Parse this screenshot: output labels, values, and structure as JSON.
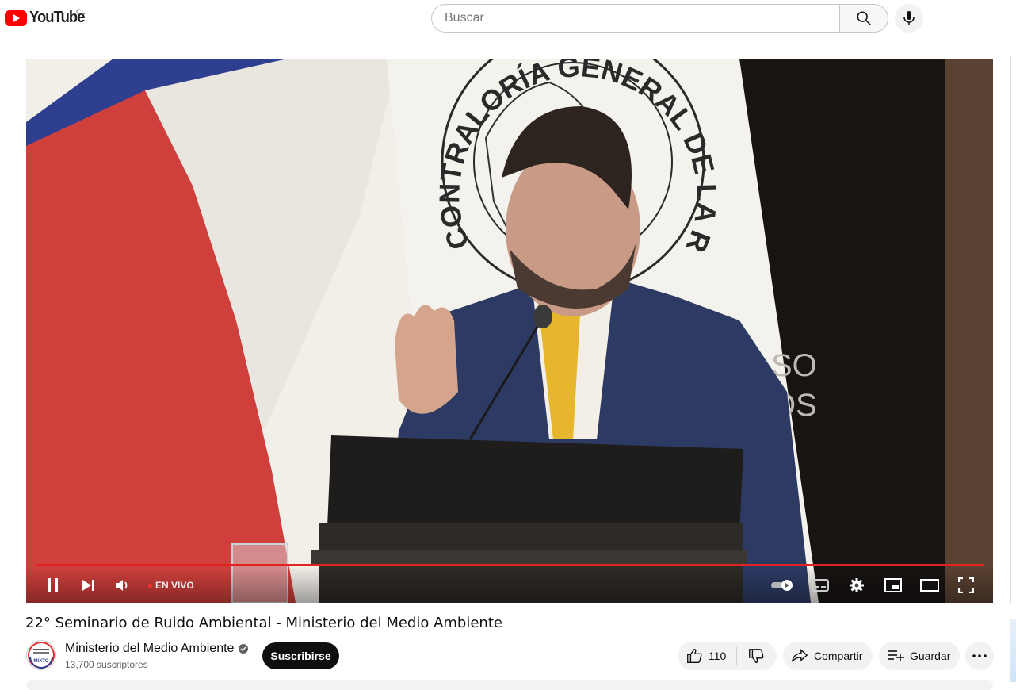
{
  "header": {
    "logo_text": "YouTube",
    "country_code": "CL",
    "search_placeholder": "Buscar",
    "icons": [
      "youtube-logo-icon",
      "search-icon",
      "microphone-icon"
    ]
  },
  "player": {
    "live_label": "EN VIVO",
    "seal_text": "CONTRALORÍA GENERAL DE LA REPÚBLICA",
    "banner_fragment": "SO\nOS",
    "colors": {
      "progress": "#e52222",
      "flag_red": "#cf3f3c",
      "flag_blue": "#2f3f8f",
      "suit": "#2d3a63",
      "tie": "#e6b62c"
    },
    "icons": [
      "pause-icon",
      "next-icon",
      "volume-icon",
      "autoplay-toggle-icon",
      "subtitles-icon",
      "settings-gear-icon",
      "miniplayer-icon",
      "theater-mode-icon",
      "fullscreen-icon"
    ]
  },
  "video": {
    "title": "22° Seminario de Ruido Ambiental - Ministerio del Medio Ambiente"
  },
  "channel": {
    "name": "Ministerio del Medio Ambiente",
    "subscribers": "13,700 suscriptores",
    "subscribe_label": "Suscribirse",
    "avatar_text": "MIXTO",
    "verified": true
  },
  "actions": {
    "likes": "110",
    "share_label": "Compartir",
    "save_label": "Guardar",
    "icons": [
      "thumbs-up-icon",
      "thumbs-down-icon",
      "share-arrow-icon",
      "playlist-add-icon",
      "more-options-icon"
    ]
  }
}
